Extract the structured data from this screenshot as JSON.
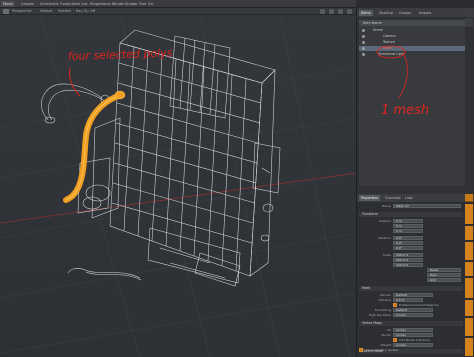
{
  "top_tabs": [
    "Modo",
    "Graphs",
    "Schematic Fusion",
    "Item List",
    "Progressive Render",
    "Shader Tree",
    "Dir"
  ],
  "viewport": {
    "header_items": [
      "Perspective",
      "Default",
      "Shaded",
      "Ray GL: Off"
    ],
    "annotation_top": "four selected polys",
    "annotation_right": "1 mesh"
  },
  "right_panel": {
    "tabs": [
      "Items",
      "Shading",
      "Groups",
      "Images"
    ],
    "list_header": "Item Name",
    "items": [
      {
        "label": "Scene",
        "indent": 1
      },
      {
        "label": "Camera",
        "indent": 3
      },
      {
        "label": "Texture",
        "indent": 3
      },
      {
        "label": "Mesh",
        "indent": 3,
        "selected": true
      },
      {
        "label": "Directional Light",
        "indent": 2
      }
    ],
    "prop_tabs": [
      "Properties",
      "Channels",
      "Lists"
    ],
    "prop_name_label": "Name",
    "prop_name_value": "Mesh (2)",
    "transform_label": "Transform",
    "position": {
      "label": "Position",
      "values": [
        "0 m",
        "0 m",
        "0 m"
      ]
    },
    "rotation": {
      "label": "Rotation",
      "values": [
        "0.0°",
        "0.0°",
        "0.0°"
      ]
    },
    "scale": {
      "label": "Scale",
      "values": [
        "100.0 %",
        "100.0 %",
        "100.0 %"
      ]
    },
    "buttons": [
      "Reset",
      "Zero",
      "Add"
    ],
    "mesh_label": "Mesh",
    "render_label": "Render",
    "render_value": "Default",
    "dissolve_label": "Dissolve",
    "dissolve_value": "0.0 %",
    "enable_cmd_label": "Enable Command Regions",
    "smoothing_label": "Smoothing",
    "smoothing_value": "Default",
    "highres_label": "High Res Mesh",
    "highres_value": "(none)",
    "vertex_maps_label": "Vertex Maps",
    "uv_label": "UV",
    "uv_value": "(none)",
    "morph_label": "Morph",
    "morph_value": "(none)",
    "add_morph_label": "Add Morph Influence",
    "weight_label": "Weight",
    "weight_value": "(none)",
    "outline_label": "Outline Mode",
    "live_update_label": "Use Geometry Update"
  },
  "colors": {
    "accent": "#d4841f",
    "annotation": "#e0241f",
    "selection": "#f0a020"
  }
}
